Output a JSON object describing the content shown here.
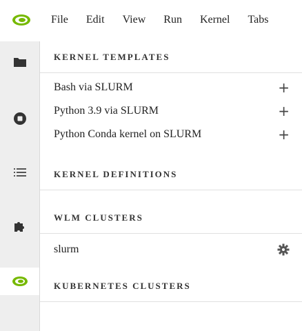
{
  "menu": {
    "items": [
      "File",
      "Edit",
      "View",
      "Run",
      "Kernel",
      "Tabs"
    ]
  },
  "sidebar": {
    "icons": [
      "folder-icon",
      "stop-icon",
      "list-icon",
      "puzzle-icon",
      "nvidia-logo-icon"
    ]
  },
  "panel": {
    "kernel_templates": {
      "title": "KERNEL TEMPLATES",
      "items": [
        {
          "label": "Bash via SLURM"
        },
        {
          "label": "Python 3.9 via SLURM"
        },
        {
          "label": "Python Conda kernel on SLURM"
        }
      ]
    },
    "kernel_definitions": {
      "title": "KERNEL DEFINITIONS"
    },
    "wlm_clusters": {
      "title": "WLM CLUSTERS",
      "items": [
        {
          "label": "slurm"
        }
      ]
    },
    "kubernetes_clusters": {
      "title": "KUBERNETES CLUSTERS"
    }
  },
  "colors": {
    "accent": "#76b900",
    "icon": "#333333",
    "sidebar_bg": "#eeeeee"
  }
}
